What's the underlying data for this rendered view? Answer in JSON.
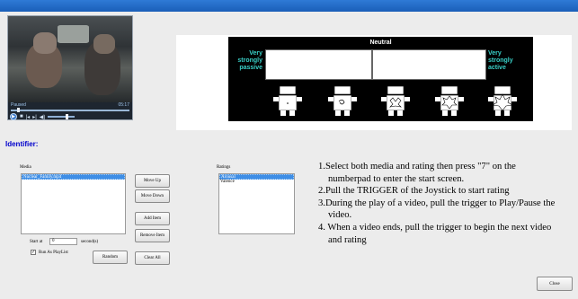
{
  "window": {
    "accent": "#1a5fb8"
  },
  "player": {
    "status": "Paused",
    "time": "05:17",
    "progress": 0.06,
    "volume": 0.7,
    "icons": [
      "play-icon",
      "stop-icon",
      "previous-icon",
      "next-icon",
      "volume-icon"
    ]
  },
  "scale": {
    "title": "Neutral",
    "left_label_1": "Very",
    "left_label_2": "strongly",
    "left_label_3": "passive",
    "right_label_1": "Very",
    "right_label_2": "strongly",
    "right_label_3": "active",
    "label_color": "#39d0c8"
  },
  "identifier": {
    "title": "Identifier:",
    "color": "#0000cc"
  },
  "media": {
    "label": "Media",
    "items": [
      "Nuclear_Family.mp4"
    ]
  },
  "buttons": {
    "move_up": "Move Up",
    "move_down": "Move Down",
    "add_item": "Add Item",
    "remove_item": "Remove Item",
    "random": "Random",
    "clear_all": "Clear All",
    "close": "Close"
  },
  "start": {
    "label": "Start at",
    "value": "0",
    "unit": "second(s)"
  },
  "playlist": {
    "label": "Run As PlayList",
    "checked": true
  },
  "ratings": {
    "label": "Ratings",
    "items": [
      "Arousal",
      "Valence"
    ]
  },
  "instructions": [
    "1.Select  both media and rating then press \"7\" on the numberpad to enter the start screen.",
    "2.Pull the TRIGGER of the Joystick to start rating",
    "3.During the play of a video, pull the trigger to Play/Pause the video.",
    "4. When a video ends, pull the trigger to begin the next video and rating"
  ]
}
